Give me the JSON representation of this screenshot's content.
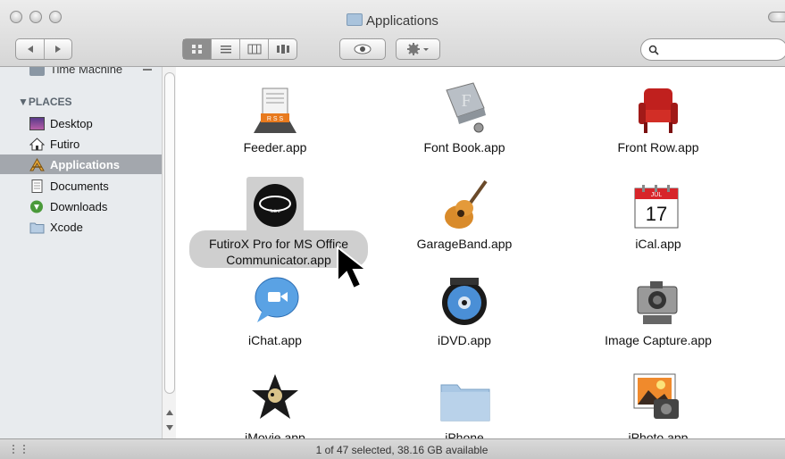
{
  "window": {
    "title": "Applications",
    "status": "1 of 47 selected, 38.16 GB available"
  },
  "toolbar": {
    "back_icon": "back-arrow-icon",
    "forward_icon": "forward-arrow-icon",
    "view_modes": [
      "icon-view-icon",
      "list-view-icon",
      "column-view-icon",
      "coverflow-view-icon"
    ],
    "active_view": "icon-view-icon",
    "quicklook_icon": "eye-icon",
    "action_icon": "gear-icon",
    "search_icon": "magnifier-icon"
  },
  "sidebar": {
    "partial_item": "Time Machine",
    "places_header": "▼PLACES",
    "items": [
      {
        "label": "Desktop",
        "icon": "desktop-icon"
      },
      {
        "label": "Futiro",
        "icon": "home-icon"
      },
      {
        "label": "Applications",
        "icon": "applications-icon",
        "selected": true
      },
      {
        "label": "Documents",
        "icon": "documents-icon"
      },
      {
        "label": "Downloads",
        "icon": "downloads-icon"
      },
      {
        "label": "Xcode",
        "icon": "folder-icon"
      }
    ]
  },
  "apps": [
    {
      "label": "Feeder.app",
      "icon": "feeder-icon"
    },
    {
      "label": "Font Book.app",
      "icon": "font-book-icon"
    },
    {
      "label": "Front Row.app",
      "icon": "front-row-icon"
    },
    {
      "label": "FutiroX Pro for MS Office",
      "label2": "Communicator.app",
      "icon": "futirox-icon",
      "selected": true
    },
    {
      "label": "GarageBand.app",
      "icon": "garageband-icon"
    },
    {
      "label": "iCal.app",
      "icon": "ical-icon",
      "day": "17",
      "month": "JUL"
    },
    {
      "label": "iChat.app",
      "icon": "ichat-icon"
    },
    {
      "label": "iDVD.app",
      "icon": "idvd-icon"
    },
    {
      "label": "Image Capture.app",
      "icon": "image-capture-icon"
    },
    {
      "label": "iMovie.app",
      "icon": "imovie-icon"
    },
    {
      "label": "iPhone",
      "icon": "folder-icon"
    },
    {
      "label": "iPhoto.app",
      "icon": "iphoto-icon"
    }
  ]
}
